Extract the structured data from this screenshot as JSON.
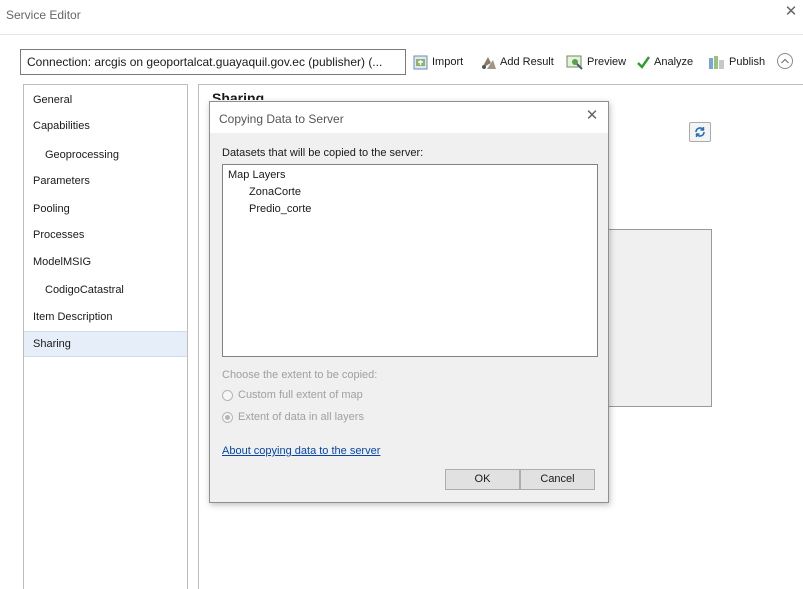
{
  "window": {
    "title": "Service Editor"
  },
  "toolbar": {
    "connection": "Connection: arcgis on geoportalcat.guayaquil.gov.ec (publisher) (...",
    "import_label": "Import",
    "add_result_label": "Add Result",
    "preview_label": "Preview",
    "analyze_label": "Analyze",
    "publish_label": "Publish"
  },
  "sidebar": {
    "items": [
      {
        "label": "General",
        "sub": false,
        "selected": false
      },
      {
        "label": "Capabilities",
        "sub": false,
        "selected": false
      },
      {
        "label": "Geoprocessing",
        "sub": true,
        "selected": false
      },
      {
        "label": "Parameters",
        "sub": false,
        "selected": false
      },
      {
        "label": "Pooling",
        "sub": false,
        "selected": false
      },
      {
        "label": "Processes",
        "sub": false,
        "selected": false
      },
      {
        "label": "ModelMSIG",
        "sub": false,
        "selected": false
      },
      {
        "label": "CodigoCatastral",
        "sub": true,
        "selected": false
      },
      {
        "label": "Item Description",
        "sub": false,
        "selected": false
      },
      {
        "label": "Sharing",
        "sub": false,
        "selected": true
      }
    ]
  },
  "content": {
    "heading": "Sharing"
  },
  "dialog": {
    "title": "Copying Data to Server",
    "datasets_label": "Datasets that will be copied to the server:",
    "tree": {
      "root": "Map Layers",
      "children": [
        "ZonaCorte",
        "Predio_corte"
      ]
    },
    "extent_label": "Choose the extent to be copied:",
    "option_custom": "Custom full extent of map",
    "option_data": "Extent of data in all layers",
    "selected_option": "Extent of data in all layers",
    "about_link": "About copying data to the server",
    "ok_label": "OK",
    "cancel_label": "Cancel"
  },
  "colors": {
    "link": "#0645ad",
    "selected_nav": "#e5eef9",
    "analyze_check": "#2e9c2e"
  }
}
